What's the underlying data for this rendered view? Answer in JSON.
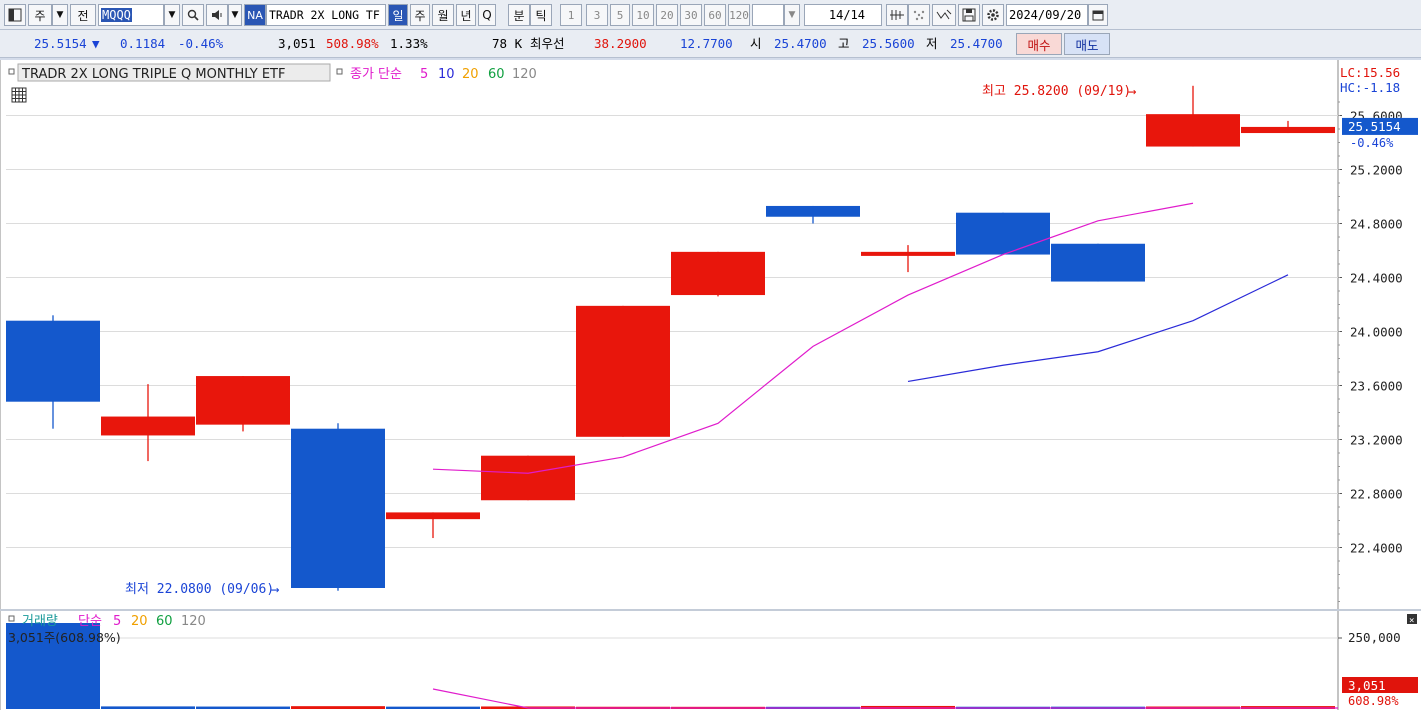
{
  "toolbar": {
    "market_label": "주",
    "all_label": "전",
    "symbol_code": "MQQQ",
    "na_badge": "NA",
    "symbol_name": "TRADR 2X LONG TF",
    "periods": [
      "일",
      "주",
      "월",
      "년",
      "Q",
      "분",
      "틱"
    ],
    "selected_period": "일",
    "intervals": [
      "1",
      "3",
      "5",
      "10",
      "20",
      "30",
      "60",
      "120"
    ],
    "count": "14",
    "count_total": "/14",
    "date": "2024/09/20"
  },
  "quote": {
    "price": "25.5154",
    "change_arrow": "▼",
    "change": "0.1184",
    "change_pct": "-0.46%",
    "volume": "3,051",
    "volume_ratio": "508.98%",
    "turnover": "1.33%",
    "book_volume": "78 K",
    "best_label": "최우선",
    "best_ask": "38.2900",
    "best_bid": "12.7700",
    "open_label": "시",
    "open": "25.4700",
    "high_label": "고",
    "high": "25.5600",
    "low_label": "저",
    "low": "25.4700",
    "buy_label": "매수",
    "sell_label": "매도"
  },
  "chart_data": {
    "type": "candlestick",
    "title": "TRADR 2X LONG TRIPLE Q MONTHLY ETF",
    "legend_label": "종가 단순",
    "ma_periods": [
      "5",
      "10",
      "20",
      "60",
      "120"
    ],
    "ma_colors": [
      "#e01ccc",
      "#2a2ad8",
      "#f0a000",
      "#10a040",
      "#888888"
    ],
    "up_color": "#e8160c",
    "down_color": "#1458cc",
    "ylim": [
      21.9,
      26.1
    ],
    "yticks": [
      "25.6000",
      "25.2000",
      "24.8000",
      "24.4000",
      "24.0000",
      "23.6000",
      "23.2000",
      "22.8000",
      "22.4000"
    ],
    "candles": [
      {
        "o": 24.08,
        "h": 24.12,
        "l": 23.28,
        "c": 23.48
      },
      {
        "o": 23.23,
        "h": 23.61,
        "l": 23.04,
        "c": 23.37
      },
      {
        "o": 23.31,
        "h": 23.67,
        "l": 23.26,
        "c": 23.67
      },
      {
        "o": 23.28,
        "h": 23.32,
        "l": 22.08,
        "c": 22.1
      },
      {
        "o": 22.61,
        "h": 22.66,
        "l": 22.47,
        "c": 22.66
      },
      {
        "o": 22.75,
        "h": 23.08,
        "l": 22.75,
        "c": 23.08
      },
      {
        "o": 23.22,
        "h": 24.19,
        "l": 23.22,
        "c": 24.19
      },
      {
        "o": 24.27,
        "h": 24.59,
        "l": 24.26,
        "c": 24.59
      },
      {
        "o": 24.93,
        "h": 24.93,
        "l": 24.8,
        "c": 24.85
      },
      {
        "o": 24.56,
        "h": 24.64,
        "l": 24.44,
        "c": 24.59
      },
      {
        "o": 24.88,
        "h": 24.88,
        "l": 24.57,
        "c": 24.57
      },
      {
        "o": 24.65,
        "h": 24.65,
        "l": 24.37,
        "c": 24.37
      },
      {
        "o": 25.37,
        "h": 25.82,
        "l": 25.37,
        "c": 25.61
      },
      {
        "o": 25.47,
        "h": 25.56,
        "l": 25.47,
        "c": 25.5154
      }
    ],
    "ma5": [
      null,
      null,
      null,
      null,
      22.98,
      22.95,
      23.07,
      23.32,
      23.89,
      24.27,
      24.57,
      24.82,
      24.95,
      null
    ],
    "ma10": [
      null,
      null,
      null,
      null,
      null,
      null,
      null,
      null,
      null,
      23.63,
      23.75,
      23.85,
      24.08,
      24.42
    ],
    "ma5_last_idx": 12,
    "ma10_start": 9,
    "high_label": "최고 25.8200 (09/19)",
    "low_label": "최저 22.0800 (09/06)",
    "lc_label": "LC:15.56",
    "hc_label": "HC:-1.18",
    "last_price_label": "25.5154",
    "last_change_label": "-0.46%",
    "volume_panel": {
      "title": "거래량",
      "legend_label": "단순",
      "ma_periods": [
        "5",
        "20",
        "60",
        "120"
      ],
      "ma_colors": [
        "#e01ccc",
        "#f0a000",
        "#10a040",
        "#888888"
      ],
      "info": "3,051주(608.98%)",
      "ytick": "250,000",
      "ylim": [
        0,
        300000
      ],
      "values": [
        290000,
        2000,
        1500,
        2800,
        1200,
        1800,
        800,
        600,
        700,
        3500,
        900,
        1100,
        1600,
        3051
      ],
      "up": [
        false,
        false,
        false,
        true,
        false,
        true,
        true,
        true,
        false,
        true,
        false,
        false,
        true,
        true
      ],
      "ma5": [
        null,
        null,
        null,
        null,
        45000,
        1900,
        null,
        null,
        null,
        null,
        null,
        null,
        null,
        null
      ],
      "last_label": "3,051",
      "last_pct": "608.98%"
    }
  }
}
